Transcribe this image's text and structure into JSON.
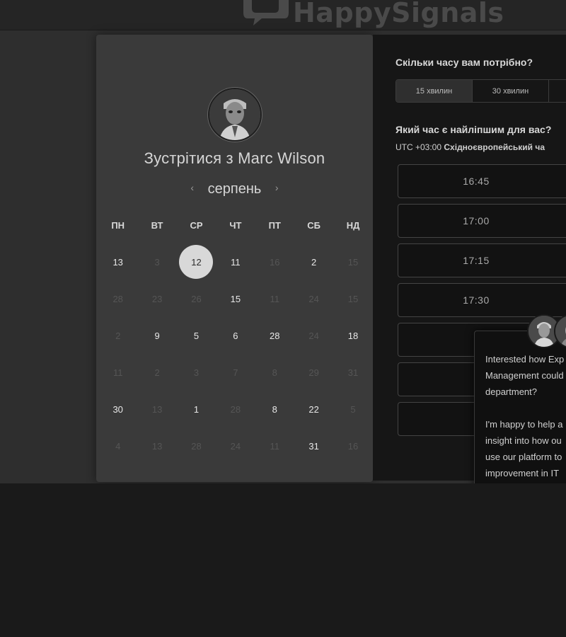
{
  "header": {
    "brand": "HappySignals"
  },
  "host": {
    "title": "Зустрітися з Marc Wilson"
  },
  "calendar": {
    "month": "серпень",
    "prev_icon": "chevron-left-icon",
    "next_icon": "chevron-right-icon",
    "weekdays": [
      "ПН",
      "ВТ",
      "СР",
      "ЧТ",
      "ПТ",
      "СБ",
      "НД"
    ],
    "selected_day": "12",
    "weeks": [
      [
        {
          "d": "13",
          "on": true
        },
        {
          "d": "3",
          "on": false
        },
        {
          "d": "12",
          "on": true,
          "sel": true
        },
        {
          "d": "11",
          "on": true
        },
        {
          "d": "16",
          "on": false
        },
        {
          "d": "2",
          "on": true
        },
        {
          "d": "15",
          "on": false
        }
      ],
      [
        {
          "d": "28",
          "on": false
        },
        {
          "d": "23",
          "on": false
        },
        {
          "d": "26",
          "on": false
        },
        {
          "d": "15",
          "on": true
        },
        {
          "d": "11",
          "on": false
        },
        {
          "d": "24",
          "on": false
        },
        {
          "d": "15",
          "on": false
        }
      ],
      [
        {
          "d": "2",
          "on": false
        },
        {
          "d": "9",
          "on": true
        },
        {
          "d": "5",
          "on": true
        },
        {
          "d": "6",
          "on": true
        },
        {
          "d": "28",
          "on": true
        },
        {
          "d": "24",
          "on": false
        },
        {
          "d": "18",
          "on": true
        }
      ],
      [
        {
          "d": "11",
          "on": false
        },
        {
          "d": "2",
          "on": false
        },
        {
          "d": "3",
          "on": false
        },
        {
          "d": "7",
          "on": false
        },
        {
          "d": "8",
          "on": false
        },
        {
          "d": "29",
          "on": false
        },
        {
          "d": "31",
          "on": false
        }
      ],
      [
        {
          "d": "30",
          "on": true
        },
        {
          "d": "13",
          "on": false
        },
        {
          "d": "1",
          "on": true
        },
        {
          "d": "28",
          "on": false
        },
        {
          "d": "8",
          "on": true
        },
        {
          "d": "22",
          "on": true
        },
        {
          "d": "5",
          "on": false
        }
      ],
      [
        {
          "d": "4",
          "on": false
        },
        {
          "d": "13",
          "on": false
        },
        {
          "d": "28",
          "on": false
        },
        {
          "d": "24",
          "on": false
        },
        {
          "d": "11",
          "on": false
        },
        {
          "d": "31",
          "on": true
        },
        {
          "d": "16",
          "on": false
        }
      ]
    ]
  },
  "duration": {
    "question": "Скільки часу вам потрібно?",
    "options": [
      "15 хвилин",
      "30 хвилин"
    ],
    "active_index": 0
  },
  "timeslots": {
    "question": "Який час є найліпшим для вас?",
    "tz_offset": "UTC +03:00",
    "tz_name": "Східноєвропейський ча",
    "times": [
      "16:45",
      "17:00",
      "17:15",
      "17:30",
      "",
      "",
      ""
    ]
  },
  "chat": {
    "message": "Interested how Exp\nManagement could\ndepartment?\n\nI'm happy to help a\ninsight into how ou\nuse our platform to\nimprovement in IT \nproductivity."
  },
  "colors": {
    "selected_day_bg": "#d8d8d8",
    "panel": "#3a3a3a",
    "right_panel": "#161616"
  }
}
